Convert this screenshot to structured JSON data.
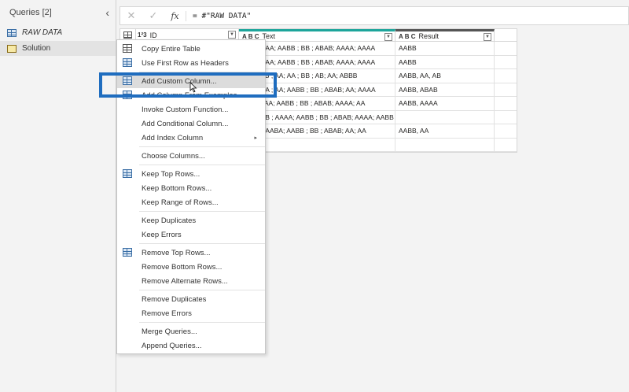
{
  "queries": {
    "header": "Queries [2]",
    "items": [
      {
        "label": "RAW DATA"
      },
      {
        "label": "Solution"
      }
    ]
  },
  "formula": {
    "cancel": "✕",
    "confirm": "✓",
    "fx": "fx",
    "text": "= #\"RAW DATA\""
  },
  "grid": {
    "columns": [
      {
        "type": "1²3",
        "name": "ID"
      },
      {
        "type": "A B C",
        "name": "Text"
      },
      {
        "type": "A B C",
        "name": "Result"
      }
    ],
    "rows": [
      {
        "id": "",
        "text": "AABB ; AA; AABB ; BB ; ABAB; AAAA; AAAA",
        "result": "AABB"
      },
      {
        "id": "",
        "text": "AABB ; AA; AABB ; BB ; ABAB; AAAA; AAAA",
        "result": "AABB"
      },
      {
        "id": "",
        "text": "A ; AABB ; AA; AA ; BB ; AB; AA; ABBB",
        "result": "AABB, AA, AB"
      },
      {
        "id": "",
        "text": "B ; ABBA ; AA; AABB ; BB ; ABAB; AA; AAAA",
        "result": "AABB, ABAB"
      },
      {
        "id": "",
        "text": "B ; AA; AA; AABB ; BB ; ABAB; AAAA; AA",
        "result": "AABB, AAAA"
      },
      {
        "id": "",
        "text": "B ; AABB ; AAAA; AABB ; BB ; ABAB; AAAA; AABB",
        "result": ""
      },
      {
        "id": "",
        "text": "AABB ; AABA; AABB ; BB ; ABAB; AA; AA",
        "result": "AABB, AA"
      },
      {
        "id": "",
        "text": "",
        "result": ""
      }
    ]
  },
  "menu": {
    "items": [
      {
        "label": "Copy Entire Table",
        "icon": "copy-icon"
      },
      {
        "label": "Use First Row as Headers",
        "icon": "table-icon"
      },
      {
        "label": "Add Custom Column...",
        "icon": "custom-column-icon"
      },
      {
        "label": "Add Column From Examples...",
        "icon": "table-icon"
      },
      {
        "label": "Invoke Custom Function..."
      },
      {
        "label": "Add Conditional Column..."
      },
      {
        "label": "Add Index Column",
        "submenu": "▸"
      },
      {
        "label": "Choose Columns..."
      },
      {
        "label": "Keep Top Rows...",
        "icon": "table-icon"
      },
      {
        "label": "Keep Bottom Rows..."
      },
      {
        "label": "Keep Range of Rows..."
      },
      {
        "label": "Keep Duplicates"
      },
      {
        "label": "Keep Errors"
      },
      {
        "label": "Remove Top Rows...",
        "icon": "table-icon"
      },
      {
        "label": "Remove Bottom Rows..."
      },
      {
        "label": "Remove Alternate Rows..."
      },
      {
        "label": "Remove Duplicates"
      },
      {
        "label": "Remove Errors"
      },
      {
        "label": "Merge Queries..."
      },
      {
        "label": "Append Queries..."
      }
    ]
  },
  "colors": {
    "highlight": "#1f6dbf",
    "text_column_accent": "#1da59b"
  }
}
